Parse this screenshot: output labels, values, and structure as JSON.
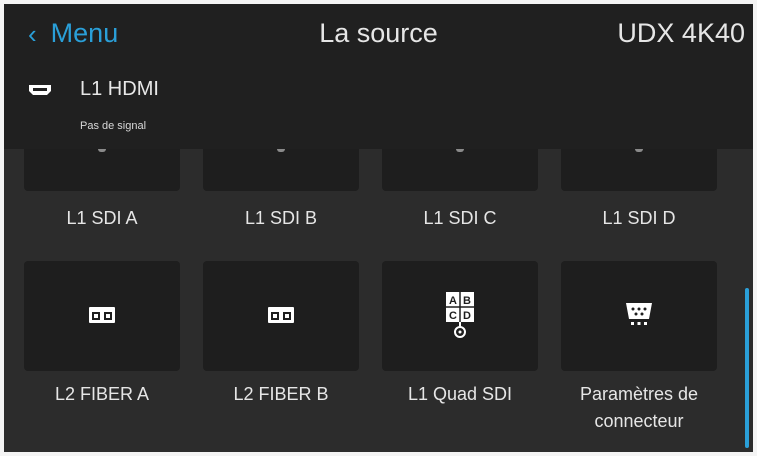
{
  "header": {
    "menu_label": "Menu",
    "title": "La source",
    "device": "UDX 4K40"
  },
  "current_source": {
    "icon": "hdmi-port-icon",
    "label": "L1 HDMI",
    "status": "Pas de signal"
  },
  "sources_top": [
    "L1 SDI A",
    "L1 SDI B",
    "L1 SDI C",
    "L1 SDI D"
  ],
  "sources_main": [
    {
      "label": "L2 FIBER A",
      "icon": "fiber-connector-icon"
    },
    {
      "label": "L2 FIBER B",
      "icon": "fiber-connector-icon"
    },
    {
      "label": "L1 Quad SDI",
      "icon": "quad-sdi-icon",
      "quad": [
        "A",
        "B",
        "C",
        "D"
      ]
    },
    {
      "label": "Paramètres de connecteur",
      "icon": "connector-settings-icon"
    }
  ],
  "colors": {
    "accent": "#2a9fd8",
    "background": "#2c2c2c",
    "header": "#202020",
    "tile": "#1e1e1e"
  }
}
